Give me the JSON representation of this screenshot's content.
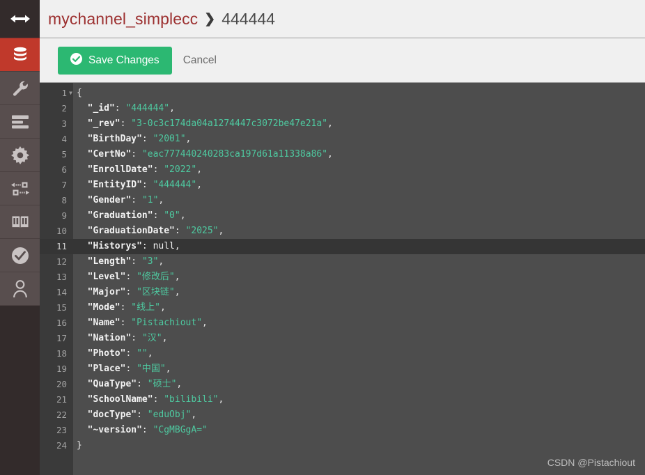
{
  "sidebar": {
    "toggle": {
      "icon": "expand-arrows-icon",
      "label": ""
    },
    "items": [
      {
        "icon": "database-icon",
        "label": "Databases",
        "active": true
      },
      {
        "icon": "wrench-icon",
        "label": "Setup",
        "active": false
      },
      {
        "icon": "list-icon",
        "label": "Active Tasks",
        "active": false
      },
      {
        "icon": "gear-icon",
        "label": "Configuration",
        "active": false
      },
      {
        "icon": "replication-icon",
        "label": "Replication",
        "active": false
      },
      {
        "icon": "book-icon",
        "label": "Documentation",
        "active": false
      },
      {
        "icon": "check-circle-icon",
        "label": "Verify",
        "active": false
      },
      {
        "icon": "user-icon",
        "label": "Account",
        "active": false
      }
    ]
  },
  "header": {
    "breadcrumb_db": "mychannel_simplecc",
    "breadcrumb_separator": "❯",
    "breadcrumb_doc": "444444"
  },
  "toolbar": {
    "save_label": "Save Changes",
    "save_icon": "check-circle-icon",
    "cancel_label": "Cancel",
    "accent_color": "#2cb872"
  },
  "editor": {
    "active_line": 11,
    "total_lines": 24,
    "lines": [
      {
        "n": 1,
        "segments": [
          {
            "t": "{",
            "c": "br"
          }
        ],
        "fold": true
      },
      {
        "n": 2,
        "segments": [
          {
            "t": "  \"_id\"",
            "c": "k"
          },
          {
            "t": ": ",
            "c": "pn"
          },
          {
            "t": "\"444444\"",
            "c": "str"
          },
          {
            "t": ",",
            "c": "pn"
          }
        ]
      },
      {
        "n": 3,
        "segments": [
          {
            "t": "  \"_rev\"",
            "c": "k"
          },
          {
            "t": ": ",
            "c": "pn"
          },
          {
            "t": "\"3-0c3c174da04a1274447c3072be47e21a\"",
            "c": "str"
          },
          {
            "t": ",",
            "c": "pn"
          }
        ]
      },
      {
        "n": 4,
        "segments": [
          {
            "t": "  \"BirthDay\"",
            "c": "k"
          },
          {
            "t": ": ",
            "c": "pn"
          },
          {
            "t": "\"2001\"",
            "c": "str"
          },
          {
            "t": ",",
            "c": "pn"
          }
        ]
      },
      {
        "n": 5,
        "segments": [
          {
            "t": "  \"CertNo\"",
            "c": "k"
          },
          {
            "t": ": ",
            "c": "pn"
          },
          {
            "t": "\"eac777440240283ca197d61a11338a86\"",
            "c": "str"
          },
          {
            "t": ",",
            "c": "pn"
          }
        ]
      },
      {
        "n": 6,
        "segments": [
          {
            "t": "  \"EnrollDate\"",
            "c": "k"
          },
          {
            "t": ": ",
            "c": "pn"
          },
          {
            "t": "\"2022\"",
            "c": "str"
          },
          {
            "t": ",",
            "c": "pn"
          }
        ]
      },
      {
        "n": 7,
        "segments": [
          {
            "t": "  \"EntityID\"",
            "c": "k"
          },
          {
            "t": ": ",
            "c": "pn"
          },
          {
            "t": "\"444444\"",
            "c": "str"
          },
          {
            "t": ",",
            "c": "pn"
          }
        ]
      },
      {
        "n": 8,
        "segments": [
          {
            "t": "  \"Gender\"",
            "c": "k"
          },
          {
            "t": ": ",
            "c": "pn"
          },
          {
            "t": "\"1\"",
            "c": "str"
          },
          {
            "t": ",",
            "c": "pn"
          }
        ]
      },
      {
        "n": 9,
        "segments": [
          {
            "t": "  \"Graduation\"",
            "c": "k"
          },
          {
            "t": ": ",
            "c": "pn"
          },
          {
            "t": "\"0\"",
            "c": "str"
          },
          {
            "t": ",",
            "c": "pn"
          }
        ]
      },
      {
        "n": 10,
        "segments": [
          {
            "t": "  \"GraduationDate\"",
            "c": "k"
          },
          {
            "t": ": ",
            "c": "pn"
          },
          {
            "t": "\"2025\"",
            "c": "str"
          },
          {
            "t": ",",
            "c": "pn"
          }
        ]
      },
      {
        "n": 11,
        "segments": [
          {
            "t": "  \"Historys\"",
            "c": "k"
          },
          {
            "t": ": ",
            "c": "pn"
          },
          {
            "t": "null",
            "c": "nul"
          },
          {
            "t": ",",
            "c": "pn"
          }
        ]
      },
      {
        "n": 12,
        "segments": [
          {
            "t": "  \"Length\"",
            "c": "k"
          },
          {
            "t": ": ",
            "c": "pn"
          },
          {
            "t": "\"3\"",
            "c": "str"
          },
          {
            "t": ",",
            "c": "pn"
          }
        ]
      },
      {
        "n": 13,
        "segments": [
          {
            "t": "  \"Level\"",
            "c": "k"
          },
          {
            "t": ": ",
            "c": "pn"
          },
          {
            "t": "\"修改后\"",
            "c": "str"
          },
          {
            "t": ",",
            "c": "pn"
          }
        ]
      },
      {
        "n": 14,
        "segments": [
          {
            "t": "  \"Major\"",
            "c": "k"
          },
          {
            "t": ": ",
            "c": "pn"
          },
          {
            "t": "\"区块链\"",
            "c": "str"
          },
          {
            "t": ",",
            "c": "pn"
          }
        ]
      },
      {
        "n": 15,
        "segments": [
          {
            "t": "  \"Mode\"",
            "c": "k"
          },
          {
            "t": ": ",
            "c": "pn"
          },
          {
            "t": "\"线上\"",
            "c": "str"
          },
          {
            "t": ",",
            "c": "pn"
          }
        ]
      },
      {
        "n": 16,
        "segments": [
          {
            "t": "  \"Name\"",
            "c": "k"
          },
          {
            "t": ": ",
            "c": "pn"
          },
          {
            "t": "\"Pistachiout\"",
            "c": "str"
          },
          {
            "t": ",",
            "c": "pn"
          }
        ]
      },
      {
        "n": 17,
        "segments": [
          {
            "t": "  \"Nation\"",
            "c": "k"
          },
          {
            "t": ": ",
            "c": "pn"
          },
          {
            "t": "\"汉\"",
            "c": "str"
          },
          {
            "t": ",",
            "c": "pn"
          }
        ]
      },
      {
        "n": 18,
        "segments": [
          {
            "t": "  \"Photo\"",
            "c": "k"
          },
          {
            "t": ": ",
            "c": "pn"
          },
          {
            "t": "\"\"",
            "c": "str"
          },
          {
            "t": ",",
            "c": "pn"
          }
        ]
      },
      {
        "n": 19,
        "segments": [
          {
            "t": "  \"Place\"",
            "c": "k"
          },
          {
            "t": ": ",
            "c": "pn"
          },
          {
            "t": "\"中国\"",
            "c": "str"
          },
          {
            "t": ",",
            "c": "pn"
          }
        ]
      },
      {
        "n": 20,
        "segments": [
          {
            "t": "  \"QuaType\"",
            "c": "k"
          },
          {
            "t": ": ",
            "c": "pn"
          },
          {
            "t": "\"硕士\"",
            "c": "str"
          },
          {
            "t": ",",
            "c": "pn"
          }
        ]
      },
      {
        "n": 21,
        "segments": [
          {
            "t": "  \"SchoolName\"",
            "c": "k"
          },
          {
            "t": ": ",
            "c": "pn"
          },
          {
            "t": "\"bilibili\"",
            "c": "str"
          },
          {
            "t": ",",
            "c": "pn"
          }
        ]
      },
      {
        "n": 22,
        "segments": [
          {
            "t": "  \"docType\"",
            "c": "k"
          },
          {
            "t": ": ",
            "c": "pn"
          },
          {
            "t": "\"eduObj\"",
            "c": "str"
          },
          {
            "t": ",",
            "c": "pn"
          }
        ]
      },
      {
        "n": 23,
        "segments": [
          {
            "t": "  \"~version\"",
            "c": "k"
          },
          {
            "t": ": ",
            "c": "pn"
          },
          {
            "t": "\"CgMBGgA=\"",
            "c": "str"
          }
        ]
      },
      {
        "n": 24,
        "segments": [
          {
            "t": "}",
            "c": "br"
          }
        ]
      }
    ]
  },
  "watermark": {
    "text": "CSDN @Pistachiout"
  }
}
